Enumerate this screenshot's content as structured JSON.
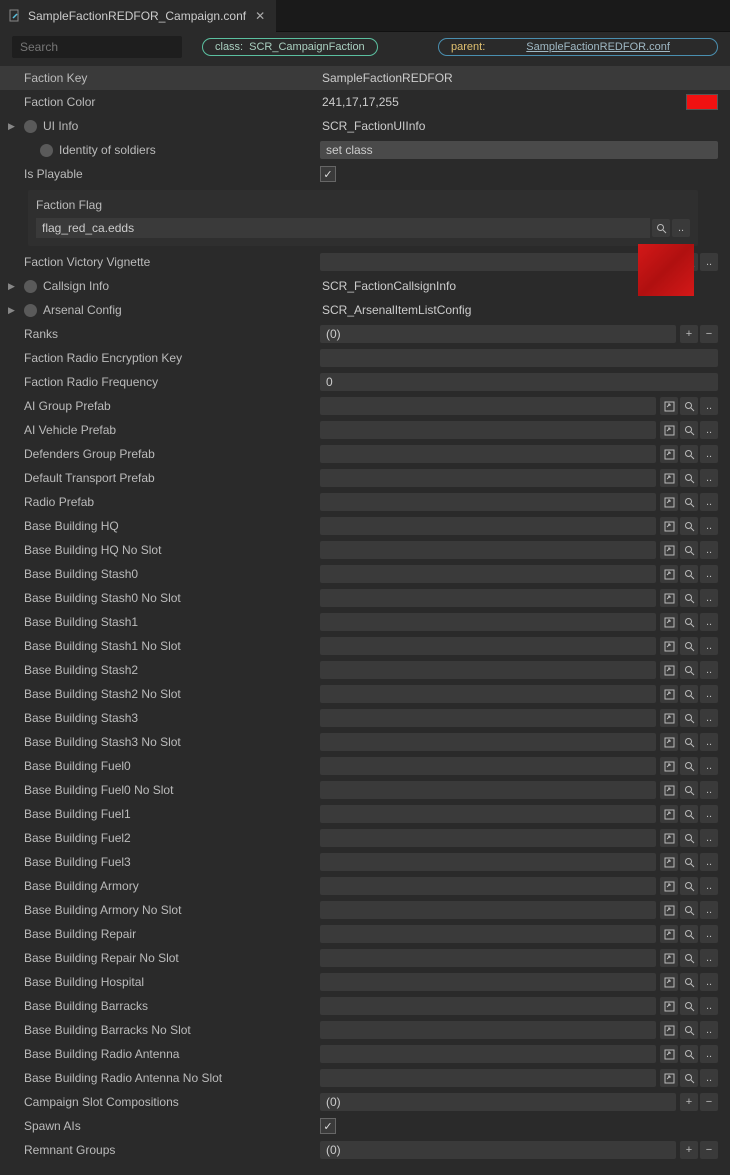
{
  "tab": {
    "title": "SampleFactionREDFOR_Campaign.conf"
  },
  "toolbar": {
    "search_placeholder": "Search",
    "class_label": "class:",
    "class_value": "SCR_CampaignFaction",
    "parent_label": "parent:",
    "parent_value": "SampleFactionREDFOR.conf"
  },
  "flag": {
    "label": "Faction Flag",
    "value": "flag_red_ca.edds"
  },
  "props": [
    {
      "label": "Faction Key",
      "type": "text",
      "value": "SampleFactionREDFOR",
      "selected": true
    },
    {
      "label": "Faction Color",
      "type": "color",
      "value": "241,17,17,255"
    },
    {
      "label": "UI Info",
      "type": "textdot",
      "value": "SCR_FactionUIInfo",
      "expander": true
    },
    {
      "label": "Identity of soldiers",
      "type": "setclass",
      "value": "set class",
      "indent": true,
      "dot": true
    },
    {
      "label": "Is Playable",
      "type": "check",
      "checked": true
    },
    {
      "label": "__FLAG__",
      "type": "flag"
    },
    {
      "label": "Faction Victory Vignette",
      "type": "resource"
    },
    {
      "label": "Callsign Info",
      "type": "textdot",
      "value": "SCR_FactionCallsignInfo",
      "expander": true
    },
    {
      "label": "Arsenal Config",
      "type": "textdot",
      "value": "SCR_ArsenalItemListConfig",
      "expander": true
    },
    {
      "label": "Ranks",
      "type": "array",
      "value": "(0)"
    },
    {
      "label": "Faction Radio Encryption Key",
      "type": "input",
      "value": ""
    },
    {
      "label": "Faction Radio Frequency",
      "type": "input",
      "value": "0"
    },
    {
      "label": "AI Group Prefab",
      "type": "resource"
    },
    {
      "label": "AI Vehicle Prefab",
      "type": "resource"
    },
    {
      "label": "Defenders Group Prefab",
      "type": "resource"
    },
    {
      "label": "Default Transport Prefab",
      "type": "resource"
    },
    {
      "label": "Radio Prefab",
      "type": "resource"
    },
    {
      "label": "Base Building HQ",
      "type": "resource"
    },
    {
      "label": "Base Building HQ No Slot",
      "type": "resource"
    },
    {
      "label": "Base Building Stash0",
      "type": "resource"
    },
    {
      "label": "Base Building Stash0 No Slot",
      "type": "resource"
    },
    {
      "label": "Base Building Stash1",
      "type": "resource"
    },
    {
      "label": "Base Building Stash1 No Slot",
      "type": "resource"
    },
    {
      "label": "Base Building Stash2",
      "type": "resource"
    },
    {
      "label": "Base Building Stash2 No Slot",
      "type": "resource"
    },
    {
      "label": "Base Building Stash3",
      "type": "resource"
    },
    {
      "label": "Base Building Stash3 No Slot",
      "type": "resource"
    },
    {
      "label": "Base Building Fuel0",
      "type": "resource"
    },
    {
      "label": "Base Building Fuel0 No Slot",
      "type": "resource"
    },
    {
      "label": "Base Building Fuel1",
      "type": "resource"
    },
    {
      "label": "Base Building Fuel2",
      "type": "resource"
    },
    {
      "label": "Base Building Fuel3",
      "type": "resource"
    },
    {
      "label": "Base Building Armory",
      "type": "resource"
    },
    {
      "label": "Base Building Armory No Slot",
      "type": "resource"
    },
    {
      "label": "Base Building Repair",
      "type": "resource"
    },
    {
      "label": "Base Building Repair No Slot",
      "type": "resource"
    },
    {
      "label": "Base Building Hospital",
      "type": "resource"
    },
    {
      "label": "Base Building Barracks",
      "type": "resource"
    },
    {
      "label": "Base Building Barracks No Slot",
      "type": "resource"
    },
    {
      "label": "Base Building Radio Antenna",
      "type": "resource"
    },
    {
      "label": "Base Building Radio Antenna No Slot",
      "type": "resource"
    },
    {
      "label": "Campaign Slot Compositions",
      "type": "array",
      "value": "(0)"
    },
    {
      "label": "Spawn AIs",
      "type": "check",
      "checked": true
    },
    {
      "label": "Remnant Groups",
      "type": "array",
      "value": "(0)"
    }
  ]
}
